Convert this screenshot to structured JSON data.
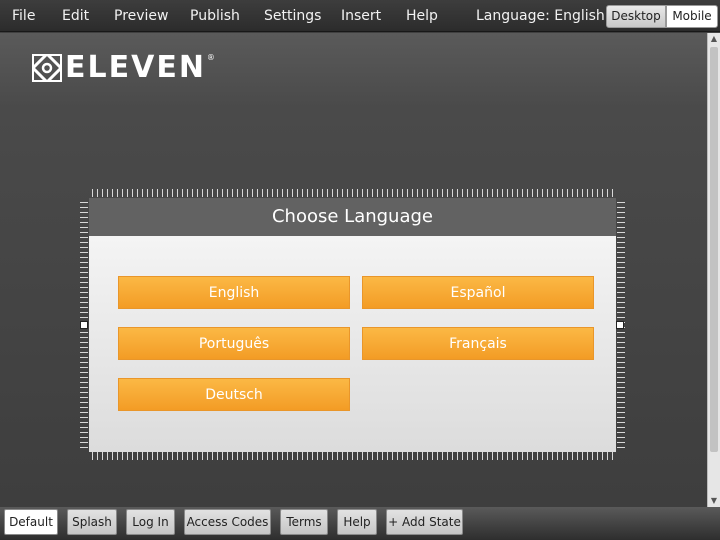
{
  "menu": {
    "items": [
      {
        "label": "File"
      },
      {
        "label": "Edit"
      },
      {
        "label": "Preview"
      },
      {
        "label": "Publish"
      },
      {
        "label": "Settings"
      },
      {
        "label": "Insert"
      },
      {
        "label": "Help"
      }
    ],
    "language_label": "Language: English",
    "views": [
      {
        "label": "Desktop",
        "selected": true
      },
      {
        "label": "Mobile",
        "selected": false
      }
    ]
  },
  "brand": {
    "name": "ELEVEN",
    "trademark": "®"
  },
  "dialog": {
    "title": "Choose Language",
    "languages": [
      {
        "label": "English"
      },
      {
        "label": "Español"
      },
      {
        "label": "Português"
      },
      {
        "label": "Français"
      },
      {
        "label": "Deutsch"
      }
    ]
  },
  "state_tabs": [
    {
      "label": "Default",
      "active": true
    },
    {
      "label": "Splash",
      "active": false
    },
    {
      "label": "Log In",
      "active": false
    },
    {
      "label": "Access Codes",
      "active": false
    },
    {
      "label": "Terms",
      "active": false
    },
    {
      "label": "Help",
      "active": false
    },
    {
      "label": "+ Add State",
      "active": false
    }
  ],
  "scrollbar": {
    "up_icon": "▲",
    "down_icon": "▼"
  },
  "colors": {
    "button_orange": "#f5a331",
    "dialog_header": "#626262",
    "background": "#444444"
  }
}
